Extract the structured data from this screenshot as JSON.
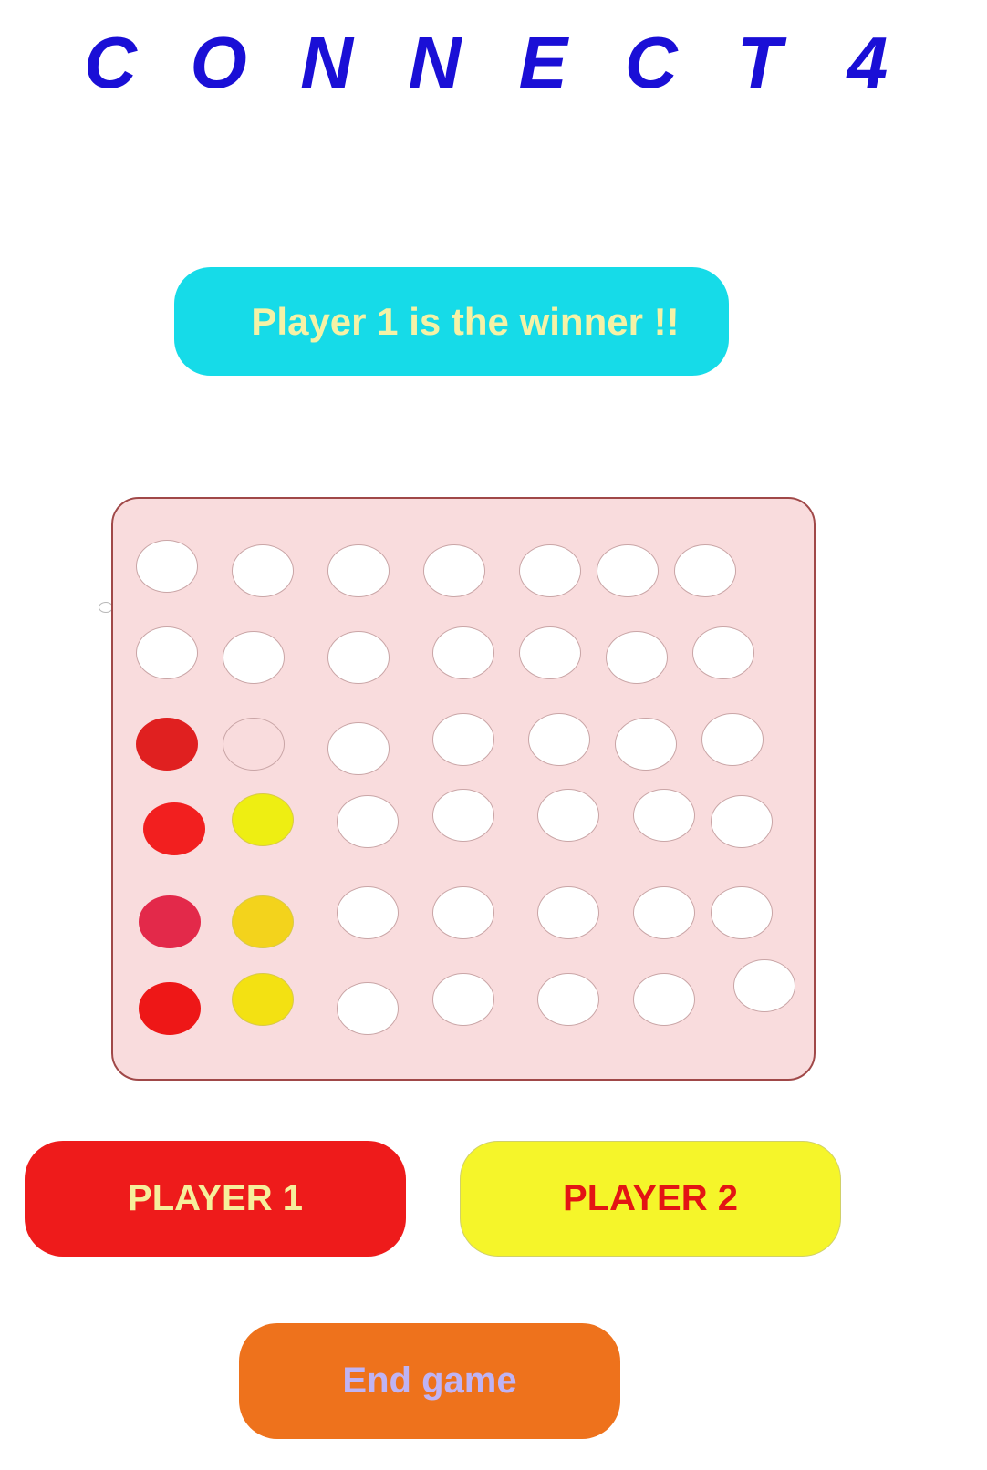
{
  "title": {
    "letters": [
      "C",
      "O",
      "N",
      "N",
      "E",
      "C",
      "T",
      "4"
    ]
  },
  "status": {
    "message": "Player 1 is the winner !!"
  },
  "board": {
    "rows": 6,
    "columns": 7,
    "cells": [
      [
        "empty",
        "empty",
        "empty",
        "empty",
        "empty",
        "empty",
        "empty"
      ],
      [
        "empty",
        "empty",
        "empty",
        "empty",
        "empty",
        "empty",
        "empty"
      ],
      [
        "red",
        "faded",
        "empty",
        "empty",
        "empty",
        "empty",
        "empty"
      ],
      [
        "red",
        "yellow",
        "empty",
        "empty",
        "empty",
        "empty",
        "empty"
      ],
      [
        "red",
        "yellow",
        "empty",
        "empty",
        "empty",
        "empty",
        "empty"
      ],
      [
        "red",
        "yellow",
        "empty",
        "empty",
        "empty",
        "empty",
        "empty"
      ]
    ],
    "piece_colors": {
      "empty": "#ffffff",
      "faded": "#f9dcdd",
      "red": "#ee1b1b",
      "yellow": "#f0e610"
    }
  },
  "buttons": {
    "player1_label": "PLAYER 1",
    "player2_label": "PLAYER 2",
    "end_game_label": "End game"
  },
  "colors": {
    "title": "#1a0fd6",
    "banner": "#16dbe8",
    "board": "#f9dcdd",
    "player1": "#ee1b1b",
    "player2": "#f5f52a",
    "end_game": "#ee721c"
  }
}
